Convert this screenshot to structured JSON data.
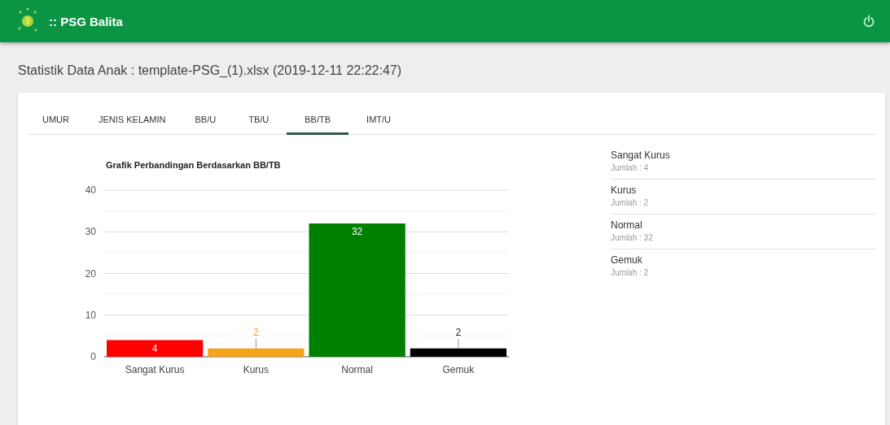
{
  "app_bar": {
    "title": ":: PSG Balita"
  },
  "page_title": "Statistik Data Anak : template-PSG_(1).xlsx (2019-12-11 22:22:47)",
  "tabs": [
    {
      "label": "UMUR",
      "selected": false
    },
    {
      "label": "JENIS KELAMIN",
      "selected": false
    },
    {
      "label": "BB/U",
      "selected": false
    },
    {
      "label": "TB/U",
      "selected": false
    },
    {
      "label": "BB/TB",
      "selected": true
    },
    {
      "label": "IMT/U",
      "selected": false
    }
  ],
  "chart": {
    "chart_data": {
      "type": "bar",
      "title": "Grafik Perbandingan Berdasarkan BB/TB",
      "categories": [
        "Sangat Kurus",
        "Kurus",
        "Normal",
        "Gemuk"
      ],
      "values": [
        4,
        2,
        32,
        2
      ],
      "grid": true,
      "colors": [
        "#ff0000",
        "#f5a31a",
        "#008000",
        "#000000"
      ],
      "value_labels": [
        "4",
        "2",
        "32",
        "2"
      ],
      "ylim": [
        0,
        40
      ],
      "yticks": [
        0,
        10,
        20,
        30,
        40
      ]
    }
  },
  "summary": [
    {
      "name": "Sangat Kurus",
      "count": "Jumlah : 4"
    },
    {
      "name": "Kurus",
      "count": "Jumlah : 2"
    },
    {
      "name": "Normal",
      "count": "Jumlah : 32"
    },
    {
      "name": "Gemuk",
      "count": "Jumlah : 2"
    }
  ]
}
